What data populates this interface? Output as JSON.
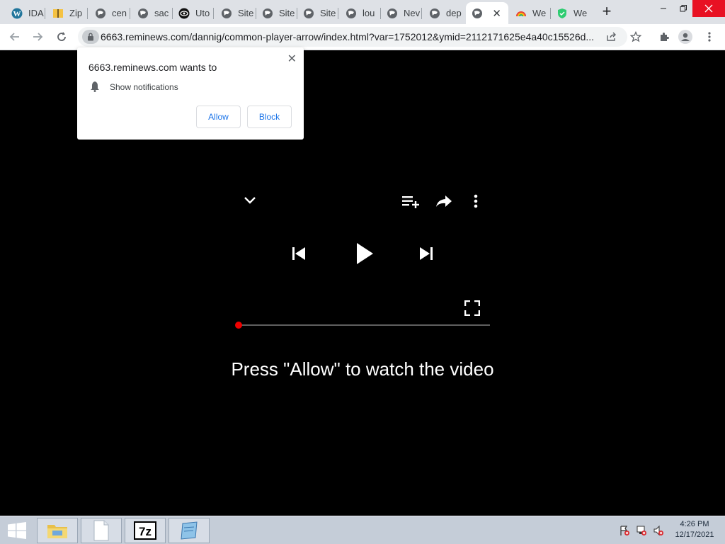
{
  "browser": {
    "tabs": [
      {
        "label": "IDA",
        "icon": "wordpress-icon"
      },
      {
        "label": "Zip",
        "icon": "zip-icon"
      },
      {
        "label": "cen",
        "icon": "globe-icon"
      },
      {
        "label": "sac",
        "icon": "globe-icon"
      },
      {
        "label": "Uto",
        "icon": "eye-icon"
      },
      {
        "label": "Site",
        "icon": "globe-icon"
      },
      {
        "label": "Site",
        "icon": "globe-icon"
      },
      {
        "label": "Site",
        "icon": "globe-icon"
      },
      {
        "label": "lou",
        "icon": "globe-icon"
      },
      {
        "label": "Nev",
        "icon": "globe-icon"
      },
      {
        "label": "dep",
        "icon": "globe-icon"
      },
      {
        "label": "",
        "icon": "globe-icon",
        "active": true
      },
      {
        "label": "We",
        "icon": "rainbow-icon"
      },
      {
        "label": "We",
        "icon": "shield-icon"
      }
    ],
    "new_tab": "+",
    "url": "6663.reminews.com/dannig/common-player-arrow/index.html?var=1752012&ymid=2112171625e4a40c15526d..."
  },
  "popup": {
    "title": "6663.reminews.com wants to",
    "permission": "Show notifications",
    "allow": "Allow",
    "block": "Block"
  },
  "player": {
    "cta": "Press \"Allow\" to watch the video",
    "progress": 0
  },
  "taskbar": {
    "time": "4:26 PM",
    "date": "12/17/2021",
    "apps": [
      "file-explorer-icon",
      "blank-document-icon",
      "7zip-icon",
      "notepad-icon"
    ]
  },
  "colors": {
    "accent": "#1a73e8",
    "progress_dot": "#ee0000"
  }
}
